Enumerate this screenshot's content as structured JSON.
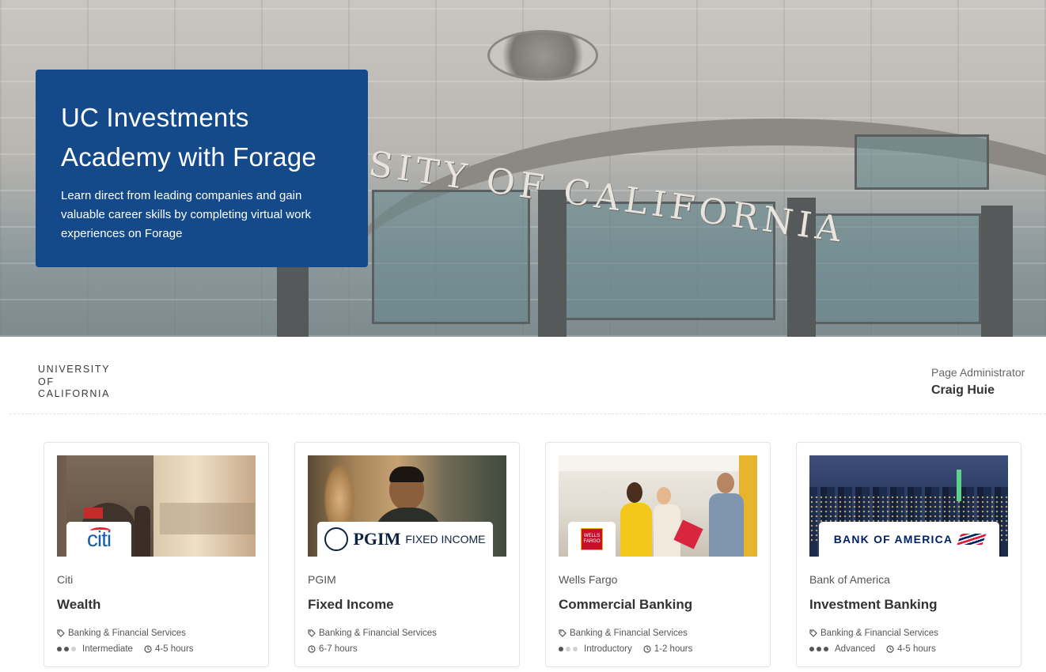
{
  "hero": {
    "title": "UC Investments Academy with Forage",
    "description": "Learn direct from leading companies and gain valuable career skills by completing virtual work experiences on Forage",
    "arch_text": "SITY OF CALIFORNIA"
  },
  "organization": {
    "logo_lines": [
      "UNIVERSITY",
      "OF",
      "CALIFORNIA"
    ]
  },
  "admin": {
    "label": "Page Administrator",
    "name": "Craig Huie"
  },
  "colors": {
    "hero_card": "#154a8a",
    "citi_blue": "#1a5eb0",
    "citi_red": "#e3242b",
    "pgim_navy": "#0d2340",
    "wells_red": "#c8102e",
    "boa_navy": "#012169",
    "boa_red": "#e31837"
  },
  "cards": [
    {
      "company": "Citi",
      "title": "Wealth",
      "logo_text": "citi",
      "tag": "Banking & Financial Services",
      "level": "Intermediate",
      "level_dots": 2,
      "duration": "4-5 hours",
      "image": "tower-bridge-photo"
    },
    {
      "company": "PGIM",
      "title": "Fixed Income",
      "logo_text": "PGIM",
      "logo_subtext": "FIXED INCOME",
      "tag": "Banking & Financial Services",
      "level": "",
      "level_dots": 0,
      "duration": "6-7 hours",
      "image": "smiling-man-photo"
    },
    {
      "company": "Wells Fargo",
      "title": "Commercial Banking",
      "logo_text": "WELLS FARGO",
      "tag": "Banking & Financial Services",
      "level": "Introductory",
      "level_dots": 1,
      "duration": "1-2 hours",
      "image": "office-team-photo"
    },
    {
      "company": "Bank of America",
      "title": "Investment Banking",
      "logo_text": "BANK OF AMERICA",
      "tag": "Banking & Financial Services",
      "level": "Advanced",
      "level_dots": 3,
      "duration": "4-5 hours",
      "image": "city-skyline-photo"
    }
  ]
}
